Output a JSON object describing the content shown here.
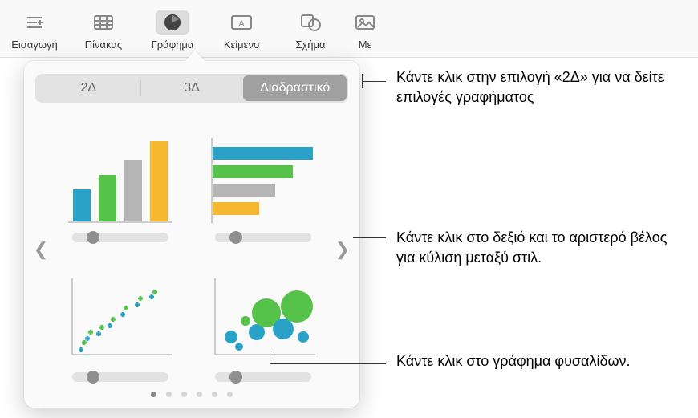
{
  "toolbar": {
    "insert": "Εισαγωγή",
    "table": "Πίνακας",
    "chart": "Γράφημα",
    "text": "Κείμενο",
    "shape": "Σχήμα",
    "media": "Με"
  },
  "segments": {
    "d2": "2Δ",
    "d3": "3Δ",
    "interactive": "Διαδραστικό"
  },
  "callouts": {
    "top": "Κάντε κλικ στην επιλογή «2Δ» για να δείτε επιλογές γραφήματος",
    "mid": "Κάντε κλικ στο δεξιό και το αριστερό βέλος για κύλιση μεταξύ στιλ.",
    "bottom": "Κάντε κλικ στο γράφημα φυσαλίδων."
  },
  "icons": {
    "insert": "insert-icon",
    "table": "table-icon",
    "chart": "piechart-icon",
    "text": "textbox-icon",
    "shape": "shape-icon",
    "media": "media-icon"
  }
}
